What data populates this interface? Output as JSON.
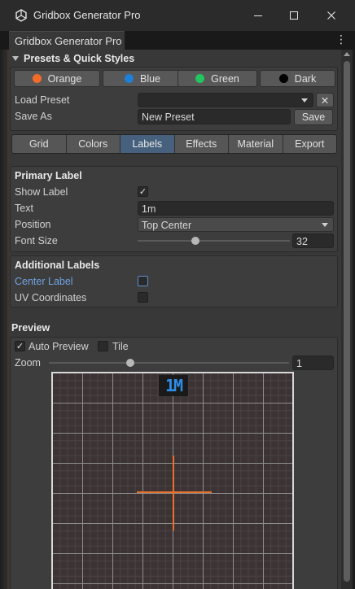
{
  "window": {
    "title": "Gridbox Generator Pro",
    "icon": "unity-cube-icon",
    "controls": [
      "minimize-icon",
      "maximize-icon",
      "close-icon"
    ]
  },
  "tab": {
    "label": "Gridbox Generator Pro",
    "menu_icon": "kebab-menu-icon"
  },
  "presets": {
    "header": "Presets & Quick Styles",
    "styles": [
      {
        "label": "Orange",
        "color": "#f26b2a"
      },
      {
        "label": "Blue",
        "color": "#1e7fd6"
      },
      {
        "label": "Green",
        "color": "#22c55e"
      },
      {
        "label": "Dark",
        "color": "#000000"
      }
    ],
    "load_label": "Load Preset",
    "load_value": "",
    "clear_glyph": "✕",
    "save_as_label": "Save As",
    "save_as_value": "New Preset",
    "save_button": "Save"
  },
  "toolbar": {
    "tabs": [
      "Grid",
      "Colors",
      "Labels",
      "Effects",
      "Material",
      "Export"
    ],
    "active": "Labels"
  },
  "primary_label": {
    "header": "Primary Label",
    "show_label": "Show Label",
    "show_checked": true,
    "text_label": "Text",
    "text_value": "1m",
    "position_label": "Position",
    "position_value": "Top Center",
    "font_size_label": "Font Size",
    "font_size_value": "32",
    "font_size_fraction": 0.37
  },
  "additional_labels": {
    "header": "Additional Labels",
    "center_label": "Center Label",
    "center_checked": false,
    "uv_label": "UV Coordinates",
    "uv_checked": false
  },
  "preview": {
    "header": "Preview",
    "auto_preview": "Auto Preview",
    "auto_checked": true,
    "tile": "Tile",
    "tile_checked": false,
    "zoom_label": "Zoom",
    "zoom_value": "1",
    "zoom_fraction": 0.34,
    "grid_label_text": "1M",
    "accent_color": "#e8702a",
    "label_color": "#2d8ee8"
  }
}
